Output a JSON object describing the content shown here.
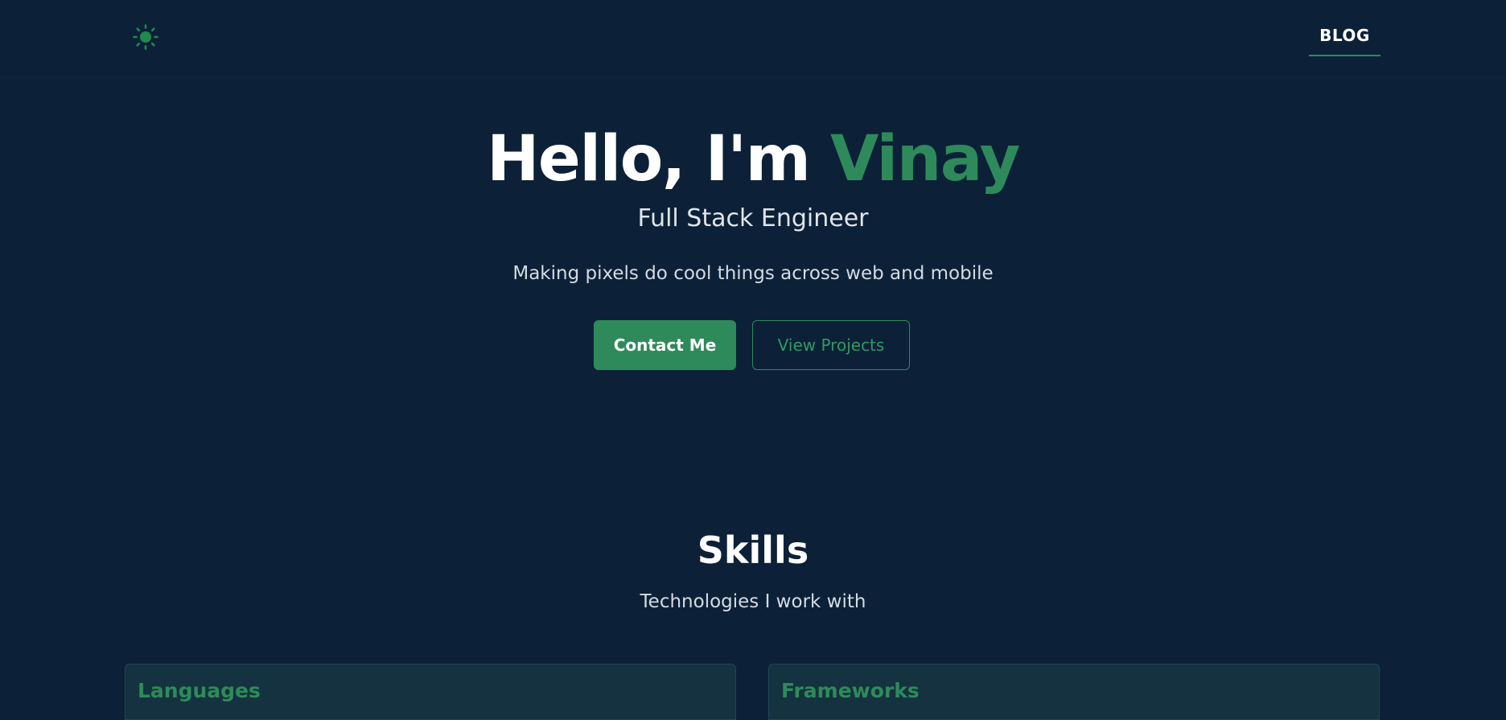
{
  "header": {
    "theme_toggle_icon": "sun-icon",
    "nav": {
      "blog_label": "BLOG"
    }
  },
  "hero": {
    "greeting": "Hello, I'm ",
    "name": "Vinay",
    "subtitle": "Full Stack Engineer",
    "tagline": "Making pixels do cool things across web and mobile",
    "contact_label": "Contact Me",
    "projects_label": "View Projects"
  },
  "skills": {
    "title": "Skills",
    "subtitle": "Technologies I work with",
    "cards": [
      {
        "title": "Languages"
      },
      {
        "title": "Frameworks"
      }
    ]
  },
  "colors": {
    "background": "#0c2138",
    "accent": "#2e8a5a",
    "card_background": "#14323f"
  }
}
